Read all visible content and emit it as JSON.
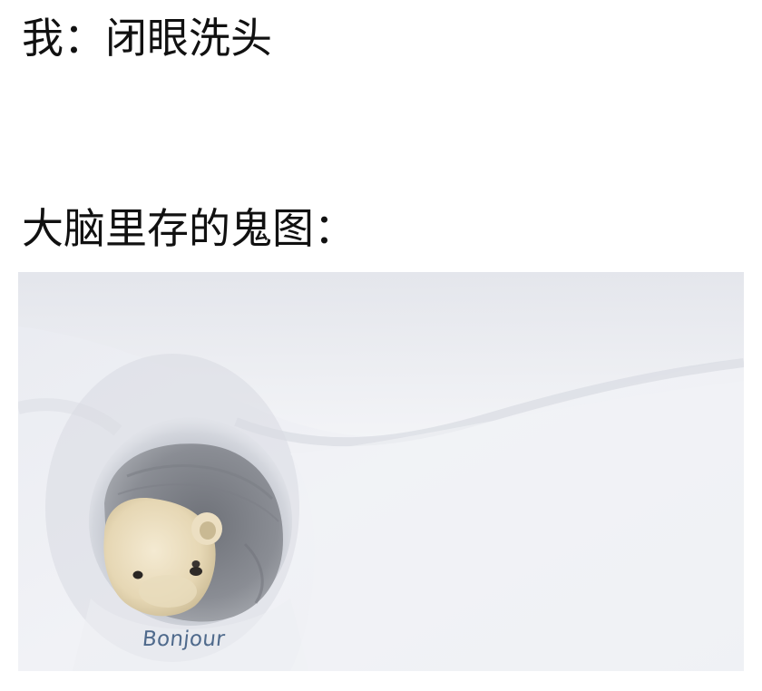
{
  "caption": {
    "line1": "我：闭眼洗头",
    "line2": "大脑里存的鬼图："
  },
  "image": {
    "label": "Bonjour",
    "label_color": "#4f6a8c",
    "snow_color": "#eef0f5"
  }
}
